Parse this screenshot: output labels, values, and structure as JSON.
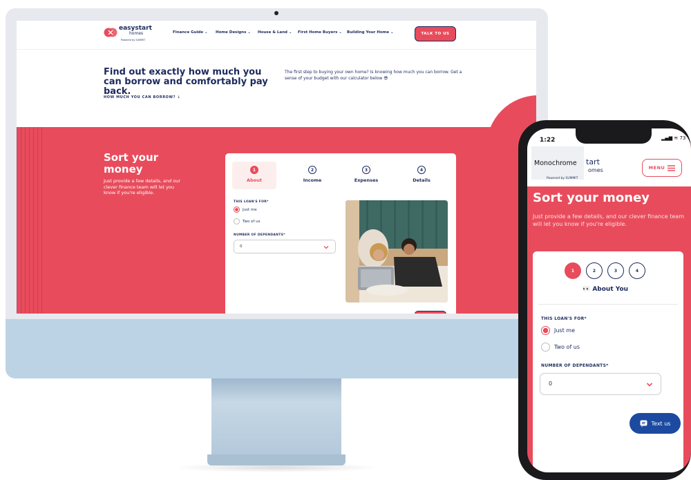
{
  "desktop": {
    "logo": {
      "word": "easystart",
      "sub": "homes",
      "powered": "Powered by SUMMIT"
    },
    "nav": [
      {
        "label": "Finance Guide"
      },
      {
        "label": "Home Designs"
      },
      {
        "label": "House & Land"
      },
      {
        "label": "First Home Buyers"
      },
      {
        "label": "Building Your Home"
      }
    ],
    "cta_label": "TALK TO US",
    "hero": {
      "title": "Find out exactly how much you can borrow and comfortably pay back.",
      "link": "HOW MUCH YOU CAN BORROW? ↓",
      "description": "The first step to buying your own home? Is knowing how much you can borrow. Get a sense of your budget with our calculator below 😎"
    },
    "section": {
      "title": "Sort your money",
      "description": "Just provide a few details, and our clever finance team will let you know if you're eligible."
    },
    "steps": [
      {
        "num": "1",
        "label": "About"
      },
      {
        "num": "2",
        "label": "Income"
      },
      {
        "num": "3",
        "label": "Expenses"
      },
      {
        "num": "4",
        "label": "Details"
      }
    ],
    "form": {
      "loan_label": "THIS LOAN'S FOR*",
      "option_1": "Just me",
      "option_2": "Two of us",
      "dependants_label": "NUMBER OF DEPENDANTS*",
      "dependants_value": "0"
    }
  },
  "mobile": {
    "time": "1:22",
    "status": "▂▄▆ ≋ 73",
    "logo": {
      "word": "Monochrome",
      "start": "tart",
      "homes": "omes",
      "powered": "Powered by SUMMIT"
    },
    "menu_label": "MENU",
    "section": {
      "title": "Sort your money",
      "description": "Just provide a few details, and our clever finance team will let you know if you're eligible."
    },
    "steps": [
      "1",
      "2",
      "3",
      "4"
    ],
    "step_title": "👀 About You",
    "form": {
      "loan_label": "THIS LOAN'S FOR*",
      "option_1": "Just me",
      "option_2": "Two of us",
      "dependants_label": "NUMBER OF DEPENDANTS*",
      "dependants_value": "0"
    },
    "text_us_label": "Text us"
  },
  "colors": {
    "brand_pink": "#e84c5c",
    "navy": "#1b2a5c",
    "chat_blue": "#1c4aa0",
    "monitor_blue": "#bcd3e6"
  }
}
